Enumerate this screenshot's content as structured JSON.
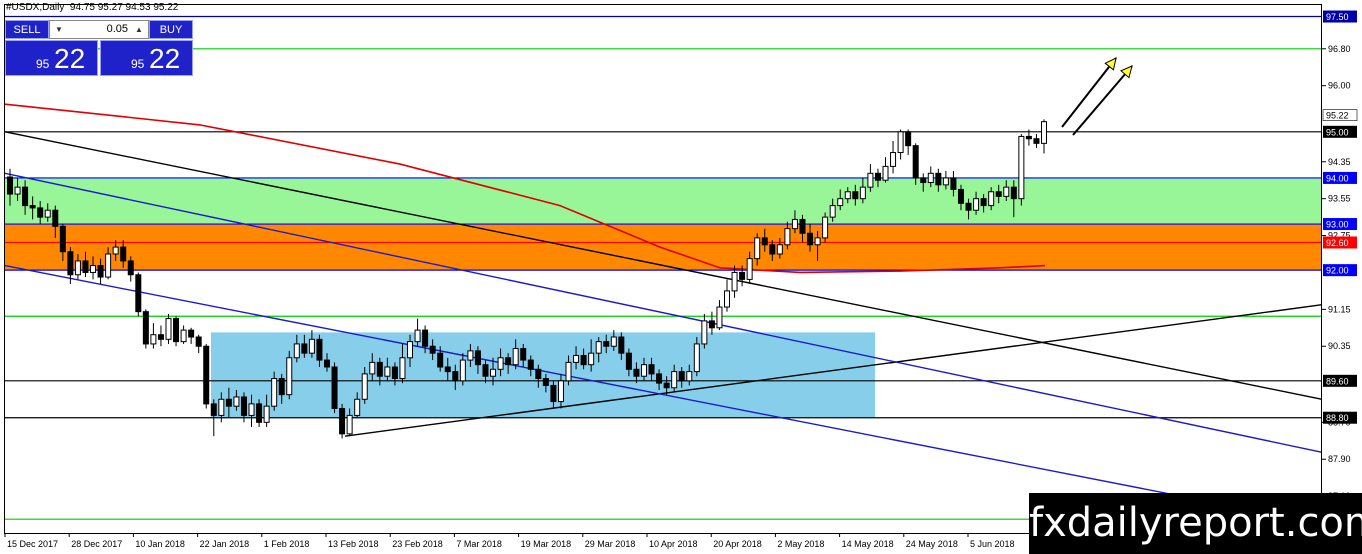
{
  "header": {
    "symbol": "#USDX,Daily",
    "ohlc": "94.75 95.27 94.53 95.22"
  },
  "trade_panel": {
    "sell_label": "SELL",
    "buy_label": "BUY",
    "lot": "0.05",
    "bid_small": "95",
    "bid_big": "22",
    "ask_small": "95",
    "ask_big": "22",
    "button_color": "#1e22c8"
  },
  "watermark": "fxdailyreport.com",
  "chart_data": {
    "type": "candlestick",
    "symbol": "#USDX",
    "timeframe": "Daily",
    "ylim": [
      86.3,
      97.75
    ],
    "grid": false,
    "y_ticks": [
      96.8,
      96.0,
      94.35,
      93.55,
      92.75,
      91.15,
      90.35,
      88.7,
      87.9,
      87.1
    ],
    "x_labels": [
      "15 Dec 2017",
      "28 Dec 2017",
      "10 Jan 2018",
      "22 Jan 2018",
      "1 Feb 2018",
      "13 Feb 2018",
      "23 Feb 2018",
      "7 Mar 2018",
      "19 Mar 2018",
      "29 Mar 2018",
      "10 Apr 2018",
      "20 Apr 2018",
      "2 May 2018",
      "14 May 2018",
      "24 May 2018",
      "5 Jun 2018"
    ],
    "price_levels": [
      {
        "price": 97.5,
        "label": "97.50",
        "color": "#0000aa"
      },
      {
        "price": 95.0,
        "label": "95.00",
        "color": "#000000"
      },
      {
        "price": 94.0,
        "label": "94.00",
        "color": "#0000ff"
      },
      {
        "price": 93.0,
        "label": "93.00",
        "color": "#0000ff"
      },
      {
        "price": 92.6,
        "label": "92.60",
        "color": "#ff0000"
      },
      {
        "price": 92.0,
        "label": "92.00",
        "color": "#0000ff"
      },
      {
        "price": 89.6,
        "label": "89.60",
        "color": "#000000"
      },
      {
        "price": 88.8,
        "label": "88.80",
        "color": "#000000"
      },
      {
        "price": 96.8,
        "label": "",
        "color": "#00cc00"
      },
      {
        "price": 91.0,
        "label": "",
        "color": "#00cc00"
      },
      {
        "price": 86.6,
        "label": "",
        "color": "#00cc00"
      }
    ],
    "current_price": {
      "price": 95.22,
      "label": "95.22"
    },
    "zones": [
      {
        "from": 93.0,
        "to": 94.0,
        "color": "#98f598"
      },
      {
        "from": 92.0,
        "to": 93.0,
        "color": "#ff8800"
      },
      {
        "from": 88.8,
        "to": 90.65,
        "x_from": 211,
        "x_to": 875,
        "color": "#87ceeb"
      }
    ],
    "trendlines": [
      {
        "x1": 5,
        "y1": 95.0,
        "x2": 1322,
        "y2": 89.2,
        "color": "#000000"
      },
      {
        "x1": 345,
        "y1": 88.4,
        "x2": 1322,
        "y2": 91.25,
        "color": "#000000"
      },
      {
        "x1": 5,
        "y1": 94.1,
        "x2": 1322,
        "y2": 88.05,
        "color": "#1a1acc"
      },
      {
        "x1": 5,
        "y1": 92.1,
        "x2": 1322,
        "y2": 86.5,
        "color": "#1a1acc"
      }
    ],
    "moving_average": {
      "color": "#e00000",
      "points": [
        [
          5,
          95.6
        ],
        [
          200,
          95.15
        ],
        [
          400,
          94.3
        ],
        [
          560,
          93.4
        ],
        [
          660,
          92.5
        ],
        [
          720,
          92.05
        ],
        [
          800,
          91.95
        ],
        [
          900,
          91.98
        ],
        [
          1000,
          92.05
        ],
        [
          1045,
          92.1
        ]
      ]
    },
    "candles": [
      [
        94.02,
        93.65,
        94.2,
        93.4
      ],
      [
        93.65,
        93.8,
        94.0,
        93.5
      ],
      [
        93.8,
        93.4,
        93.95,
        93.2
      ],
      [
        93.4,
        93.35,
        93.6,
        93.1
      ],
      [
        93.35,
        93.15,
        93.5,
        93.0
      ],
      [
        93.15,
        93.3,
        93.45,
        93.05
      ],
      [
        93.3,
        92.95,
        93.4,
        92.7
      ],
      [
        92.95,
        92.4,
        93.0,
        92.2
      ],
      [
        92.4,
        91.9,
        92.5,
        91.7
      ],
      [
        91.9,
        92.2,
        92.35,
        91.8
      ],
      [
        92.2,
        91.95,
        92.4,
        91.85
      ],
      [
        91.95,
        92.1,
        92.3,
        91.8
      ],
      [
        92.1,
        91.85,
        92.25,
        91.7
      ],
      [
        91.85,
        92.35,
        92.5,
        91.8
      ],
      [
        92.35,
        92.5,
        92.65,
        92.2
      ],
      [
        92.5,
        92.2,
        92.65,
        92.05
      ],
      [
        92.2,
        91.9,
        92.3,
        91.75
      ],
      [
        91.9,
        91.1,
        91.95,
        91.0
      ],
      [
        91.1,
        90.4,
        91.15,
        90.3
      ],
      [
        90.4,
        90.6,
        90.85,
        90.3
      ],
      [
        90.6,
        90.5,
        90.8,
        90.35
      ],
      [
        90.5,
        90.95,
        91.05,
        90.4
      ],
      [
        90.95,
        90.45,
        91.0,
        90.35
      ],
      [
        90.45,
        90.7,
        90.8,
        90.4
      ],
      [
        90.7,
        90.55,
        90.75,
        90.4
      ],
      [
        90.55,
        90.35,
        90.6,
        90.2
      ],
      [
        90.35,
        89.1,
        90.4,
        89.0
      ],
      [
        89.1,
        88.85,
        89.2,
        88.4
      ],
      [
        88.85,
        89.2,
        89.35,
        88.7
      ],
      [
        89.2,
        89.05,
        89.45,
        88.8
      ],
      [
        89.05,
        89.25,
        89.4,
        88.95
      ],
      [
        89.25,
        88.85,
        89.35,
        88.7
      ],
      [
        88.85,
        89.1,
        89.3,
        88.6
      ],
      [
        89.1,
        88.7,
        89.2,
        88.6
      ],
      [
        88.7,
        89.05,
        89.3,
        88.6
      ],
      [
        89.05,
        89.65,
        89.8,
        88.95
      ],
      [
        89.65,
        89.3,
        89.75,
        89.1
      ],
      [
        89.3,
        90.1,
        90.25,
        89.2
      ],
      [
        90.1,
        90.4,
        90.6,
        90.0
      ],
      [
        90.4,
        90.2,
        90.6,
        90.1
      ],
      [
        90.2,
        90.5,
        90.7,
        90.1
      ],
      [
        90.5,
        90.05,
        90.6,
        89.9
      ],
      [
        90.05,
        89.9,
        90.2,
        89.8
      ],
      [
        89.9,
        89.0,
        90.0,
        88.9
      ],
      [
        89.0,
        88.45,
        89.1,
        88.35
      ],
      [
        88.45,
        88.85,
        89.0,
        88.4
      ],
      [
        88.85,
        89.2,
        89.35,
        88.8
      ],
      [
        89.2,
        89.75,
        89.9,
        89.1
      ],
      [
        89.75,
        90.0,
        90.2,
        89.6
      ],
      [
        90.0,
        89.7,
        90.1,
        89.5
      ],
      [
        89.7,
        89.9,
        90.1,
        89.6
      ],
      [
        89.9,
        89.65,
        90.0,
        89.5
      ],
      [
        89.65,
        90.1,
        90.4,
        89.55
      ],
      [
        90.1,
        90.45,
        90.6,
        89.9
      ],
      [
        90.45,
        90.7,
        90.95,
        90.35
      ],
      [
        90.7,
        90.35,
        90.8,
        90.2
      ],
      [
        90.35,
        90.2,
        90.5,
        90.05
      ],
      [
        90.2,
        89.9,
        90.35,
        89.8
      ],
      [
        89.9,
        89.8,
        90.1,
        89.6
      ],
      [
        89.8,
        89.6,
        89.95,
        89.4
      ],
      [
        89.6,
        90.05,
        90.2,
        89.5
      ],
      [
        90.05,
        90.25,
        90.4,
        89.9
      ],
      [
        90.25,
        89.95,
        90.35,
        89.75
      ],
      [
        89.95,
        89.7,
        90.05,
        89.55
      ],
      [
        89.7,
        89.85,
        90.1,
        89.5
      ],
      [
        89.85,
        90.1,
        90.3,
        89.7
      ],
      [
        90.1,
        89.95,
        90.2,
        89.75
      ],
      [
        89.95,
        90.3,
        90.5,
        89.85
      ],
      [
        90.3,
        90.05,
        90.4,
        89.9
      ],
      [
        90.05,
        89.85,
        90.15,
        89.7
      ],
      [
        89.85,
        89.65,
        89.95,
        89.45
      ],
      [
        89.65,
        89.5,
        89.75,
        89.35
      ],
      [
        89.5,
        89.15,
        89.6,
        89.0
      ],
      [
        89.15,
        89.6,
        89.75,
        89.0
      ],
      [
        89.6,
        90.0,
        90.15,
        89.5
      ],
      [
        90.0,
        90.15,
        90.35,
        89.85
      ],
      [
        90.15,
        89.95,
        90.3,
        89.85
      ],
      [
        89.95,
        90.2,
        90.5,
        89.8
      ],
      [
        90.2,
        90.45,
        90.55,
        90.0
      ],
      [
        90.45,
        90.35,
        90.6,
        90.2
      ],
      [
        90.35,
        90.55,
        90.7,
        90.25
      ],
      [
        90.55,
        90.2,
        90.65,
        90.05
      ],
      [
        90.2,
        89.85,
        90.3,
        89.7
      ],
      [
        89.85,
        89.7,
        90.0,
        89.55
      ],
      [
        89.7,
        89.95,
        90.1,
        89.6
      ],
      [
        89.95,
        89.75,
        90.1,
        89.6
      ],
      [
        89.75,
        89.55,
        89.85,
        89.4
      ],
      [
        89.55,
        89.45,
        89.7,
        89.3
      ],
      [
        89.45,
        89.8,
        89.95,
        89.35
      ],
      [
        89.8,
        89.6,
        89.9,
        89.45
      ],
      [
        89.6,
        89.8,
        89.95,
        89.5
      ],
      [
        89.8,
        90.4,
        90.55,
        89.7
      ],
      [
        90.4,
        90.9,
        91.05,
        90.3
      ],
      [
        90.9,
        90.75,
        91.1,
        90.6
      ],
      [
        90.75,
        91.2,
        91.35,
        90.7
      ],
      [
        91.2,
        91.55,
        91.8,
        91.1
      ],
      [
        91.55,
        91.95,
        92.1,
        91.4
      ],
      [
        91.95,
        91.8,
        92.1,
        91.65
      ],
      [
        91.8,
        92.25,
        92.4,
        91.7
      ],
      [
        92.25,
        92.7,
        92.8,
        92.1
      ],
      [
        92.7,
        92.55,
        92.9,
        92.4
      ],
      [
        92.55,
        92.35,
        92.65,
        92.2
      ],
      [
        92.35,
        92.55,
        92.7,
        92.25
      ],
      [
        92.55,
        92.9,
        93.05,
        92.45
      ],
      [
        92.9,
        93.1,
        93.3,
        92.8
      ],
      [
        93.1,
        92.8,
        93.2,
        92.6
      ],
      [
        92.8,
        92.55,
        93.0,
        92.4
      ],
      [
        92.55,
        92.7,
        92.85,
        92.2
      ],
      [
        92.7,
        93.15,
        93.25,
        92.6
      ],
      [
        93.15,
        93.4,
        93.55,
        93.05
      ],
      [
        93.4,
        93.55,
        93.75,
        93.3
      ],
      [
        93.55,
        93.7,
        93.8,
        93.45
      ],
      [
        93.7,
        93.55,
        93.85,
        93.4
      ],
      [
        93.55,
        93.8,
        94.0,
        93.45
      ],
      [
        93.8,
        94.1,
        94.3,
        93.7
      ],
      [
        94.1,
        93.95,
        94.2,
        93.8
      ],
      [
        93.95,
        94.25,
        94.45,
        93.9
      ],
      [
        94.25,
        94.55,
        94.8,
        94.1
      ],
      [
        94.55,
        95.0,
        95.05,
        94.4
      ],
      [
        95.0,
        94.7,
        95.05,
        94.5
      ],
      [
        94.7,
        94.0,
        94.75,
        93.85
      ],
      [
        94.0,
        93.9,
        94.1,
        93.7
      ],
      [
        93.9,
        94.1,
        94.25,
        93.8
      ],
      [
        94.1,
        93.85,
        94.2,
        93.7
      ],
      [
        93.85,
        94.0,
        94.15,
        93.75
      ],
      [
        94.0,
        93.75,
        94.15,
        93.6
      ],
      [
        93.75,
        93.45,
        93.85,
        93.3
      ],
      [
        93.45,
        93.3,
        93.55,
        93.1
      ],
      [
        93.3,
        93.55,
        93.7,
        93.2
      ],
      [
        93.55,
        93.4,
        93.65,
        93.25
      ],
      [
        93.4,
        93.7,
        93.8,
        93.3
      ],
      [
        93.7,
        93.6,
        93.85,
        93.45
      ],
      [
        93.6,
        93.8,
        93.95,
        93.5
      ],
      [
        93.8,
        93.55,
        93.95,
        93.15
      ],
      [
        93.55,
        94.9,
        94.95,
        93.4
      ],
      [
        94.9,
        94.85,
        95.05,
        94.7
      ],
      [
        94.85,
        94.75,
        94.95,
        94.65
      ],
      [
        94.75,
        95.22,
        95.27,
        94.53
      ]
    ]
  }
}
